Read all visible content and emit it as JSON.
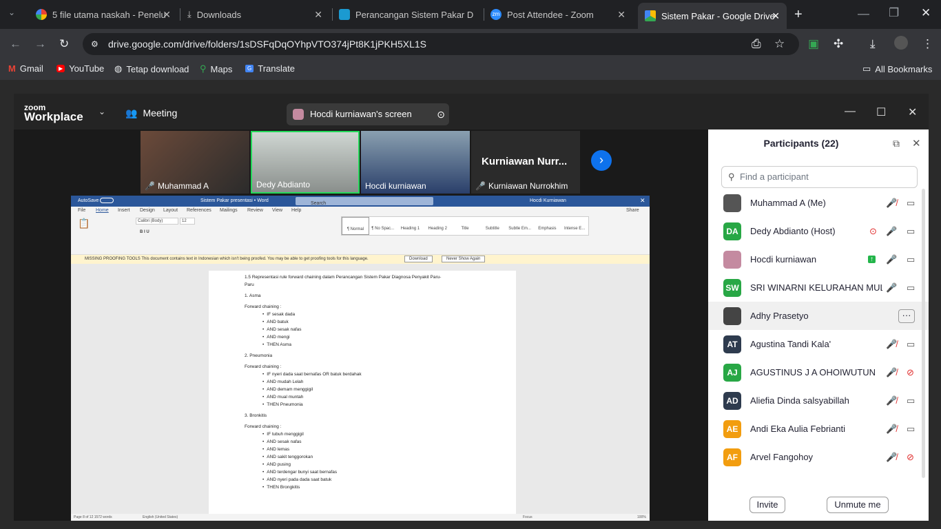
{
  "browser": {
    "tabs": [
      {
        "title": "5 file utama naskah - Penelu",
        "icon": "google-icon"
      },
      {
        "title": "Downloads",
        "icon": "download-icon"
      },
      {
        "title": "Perancangan Sistem Pakar D",
        "icon": "app-icon"
      },
      {
        "title": "Post Attendee - Zoom",
        "icon": "zoom-icon"
      },
      {
        "title": "Sistem Pakar - Google Drive",
        "icon": "drive-icon"
      }
    ],
    "url": "drive.google.com/drive/folders/1sDSFqDqOYhpVTO374jPt8K1jPKH5XL1S",
    "bookmarks": [
      "Gmail",
      "YouTube",
      "Tetap download",
      "Maps",
      "Translate"
    ],
    "all_bookmarks": "All Bookmarks"
  },
  "zoom": {
    "logo_top": "zoom",
    "logo_bottom": "Workplace",
    "meeting_label": "Meeting",
    "share_label": "Hocdi kurniawan's screen",
    "thumbnails": [
      "Muhammad A",
      "Dedy Abdianto",
      "Hocdi kurniawan",
      "Kurniawan Nurrokhim"
    ],
    "thumb_big_name": "Kurniawan  Nurr...",
    "participants_title": "Participants (22)",
    "search_placeholder": "Find a participant",
    "participants": [
      {
        "name": "Muhammad A (Me)",
        "initials": "",
        "color": "#555555"
      },
      {
        "name": "Dedy Abdianto (Host)",
        "initials": "DA",
        "color": "#28a745"
      },
      {
        "name": "Hocdi kurniawan",
        "initials": "",
        "color": "#c48aa0"
      },
      {
        "name": "SRI WINARNI KELURAHAN MULI",
        "initials": "SW",
        "color": "#28a745"
      },
      {
        "name": "Adhy Prasetyo",
        "initials": "",
        "color": "#444444"
      },
      {
        "name": "Agustina Tandi Kala'",
        "initials": "AT",
        "color": "#2e3b4e"
      },
      {
        "name": "AGUSTINUS J A OHOIWUTUN",
        "initials": "AJ",
        "color": "#28a745"
      },
      {
        "name": "Aliefia Dinda salsyabillah",
        "initials": "AD",
        "color": "#2e3b4e"
      },
      {
        "name": "Andi Eka Aulia Febrianti",
        "initials": "AE",
        "color": "#f29d0f"
      },
      {
        "name": "Arvel Fangohoy",
        "initials": "AF",
        "color": "#f29d0f"
      }
    ],
    "invite": "Invite",
    "unmute": "Unmute me"
  },
  "word": {
    "autosave": "AutoSave",
    "title": "Sistem Pakar presentasi  •  Word",
    "search": "Search",
    "user": "Hocdi Kurniawan",
    "tabs": [
      "File",
      "Home",
      "Insert",
      "Design",
      "Layout",
      "References",
      "Mailings",
      "Review",
      "View",
      "Help"
    ],
    "share": "Share",
    "font": "Calibri (Body)",
    "size": "12",
    "styles": [
      "¶ Normal",
      "¶ No Spac...",
      "Heading 1",
      "Heading 2",
      "Title",
      "Subtitle",
      "Subtle Em...",
      "Emphasis",
      "Intense E..."
    ],
    "warning": "MISSING PROOFING TOOLS   This document contains text in Indonesian which isn't being proofed. You may be able to get proofing tools for this language.",
    "download": "Download",
    "never": "Never Show Again",
    "doc_lines": [
      "1.5 Representasi rule  forward chaining dalam Perancangan Sistem Pakar Diagnosa Penyakit Paru-",
      "Paru",
      "1. Asma",
      "Forward chaining :",
      "2. Pneumonia",
      "Forward chaining :",
      "3. Bronkitis",
      "Forward chaining :"
    ],
    "asma": [
      "IF sesak dada",
      "AND batuk",
      "AND sesak nafas",
      "AND mengi",
      "THEN Asma"
    ],
    "pneumonia": [
      "IF nyeri dada saat bernafas OR batuk berdahak",
      "AND mudah Lelah",
      "AND demam menggigil",
      "AND mual muntah",
      "THEN Pneumonia"
    ],
    "bronkitis": [
      "IF tubuh menggigil",
      "AND sesak nafas",
      "AND lemas",
      "AND sakit tenggorokan",
      "AND pusing",
      "AND terdengar bunyi saat bernafas",
      "AND nyeri pada dada saat batuk",
      "THEN Brongkitis"
    ],
    "status_page": "Page 8 of 12    1572 words",
    "status_lang": "English (United States)",
    "status_focus": "Focus",
    "zoom": "100%"
  }
}
